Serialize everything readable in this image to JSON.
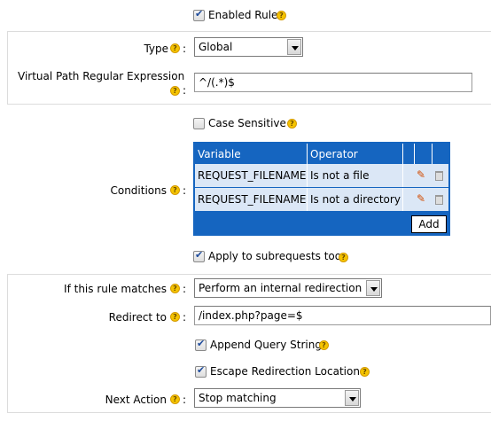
{
  "enabled_rule": {
    "label": "Enabled Rule",
    "checked": true
  },
  "type": {
    "label": "Type",
    "value": "Global"
  },
  "virtual_path": {
    "label": "Virtual Path Regular Expression",
    "value": "^/(.*)$"
  },
  "case_sensitive": {
    "label": "Case Sensitive",
    "checked": false
  },
  "conditions": {
    "label": "Conditions",
    "columns": [
      "Variable",
      "Operator"
    ],
    "rows": [
      {
        "variable": "REQUEST_FILENAME",
        "operator": "Is not a file"
      },
      {
        "variable": "REQUEST_FILENAME",
        "operator": "Is not a directory"
      }
    ],
    "add_label": "Add"
  },
  "apply_subrequests": {
    "label": "Apply to subrequests too",
    "checked": true
  },
  "if_matches": {
    "label": "If this rule matches",
    "value": "Perform an internal redirection"
  },
  "redirect_to": {
    "label": "Redirect to",
    "value": "/index.php?page=$"
  },
  "append_query": {
    "label": "Append Query String",
    "checked": true
  },
  "escape_redirection": {
    "label": "Escape Redirection Location",
    "checked": true
  },
  "next_action": {
    "label": "Next Action",
    "value": "Stop matching"
  },
  "colon": ":",
  "help_glyph": "?",
  "colors": {
    "grid_header": "#1565c0",
    "grid_row": "#dbe7f6",
    "help": "#f5c400"
  }
}
